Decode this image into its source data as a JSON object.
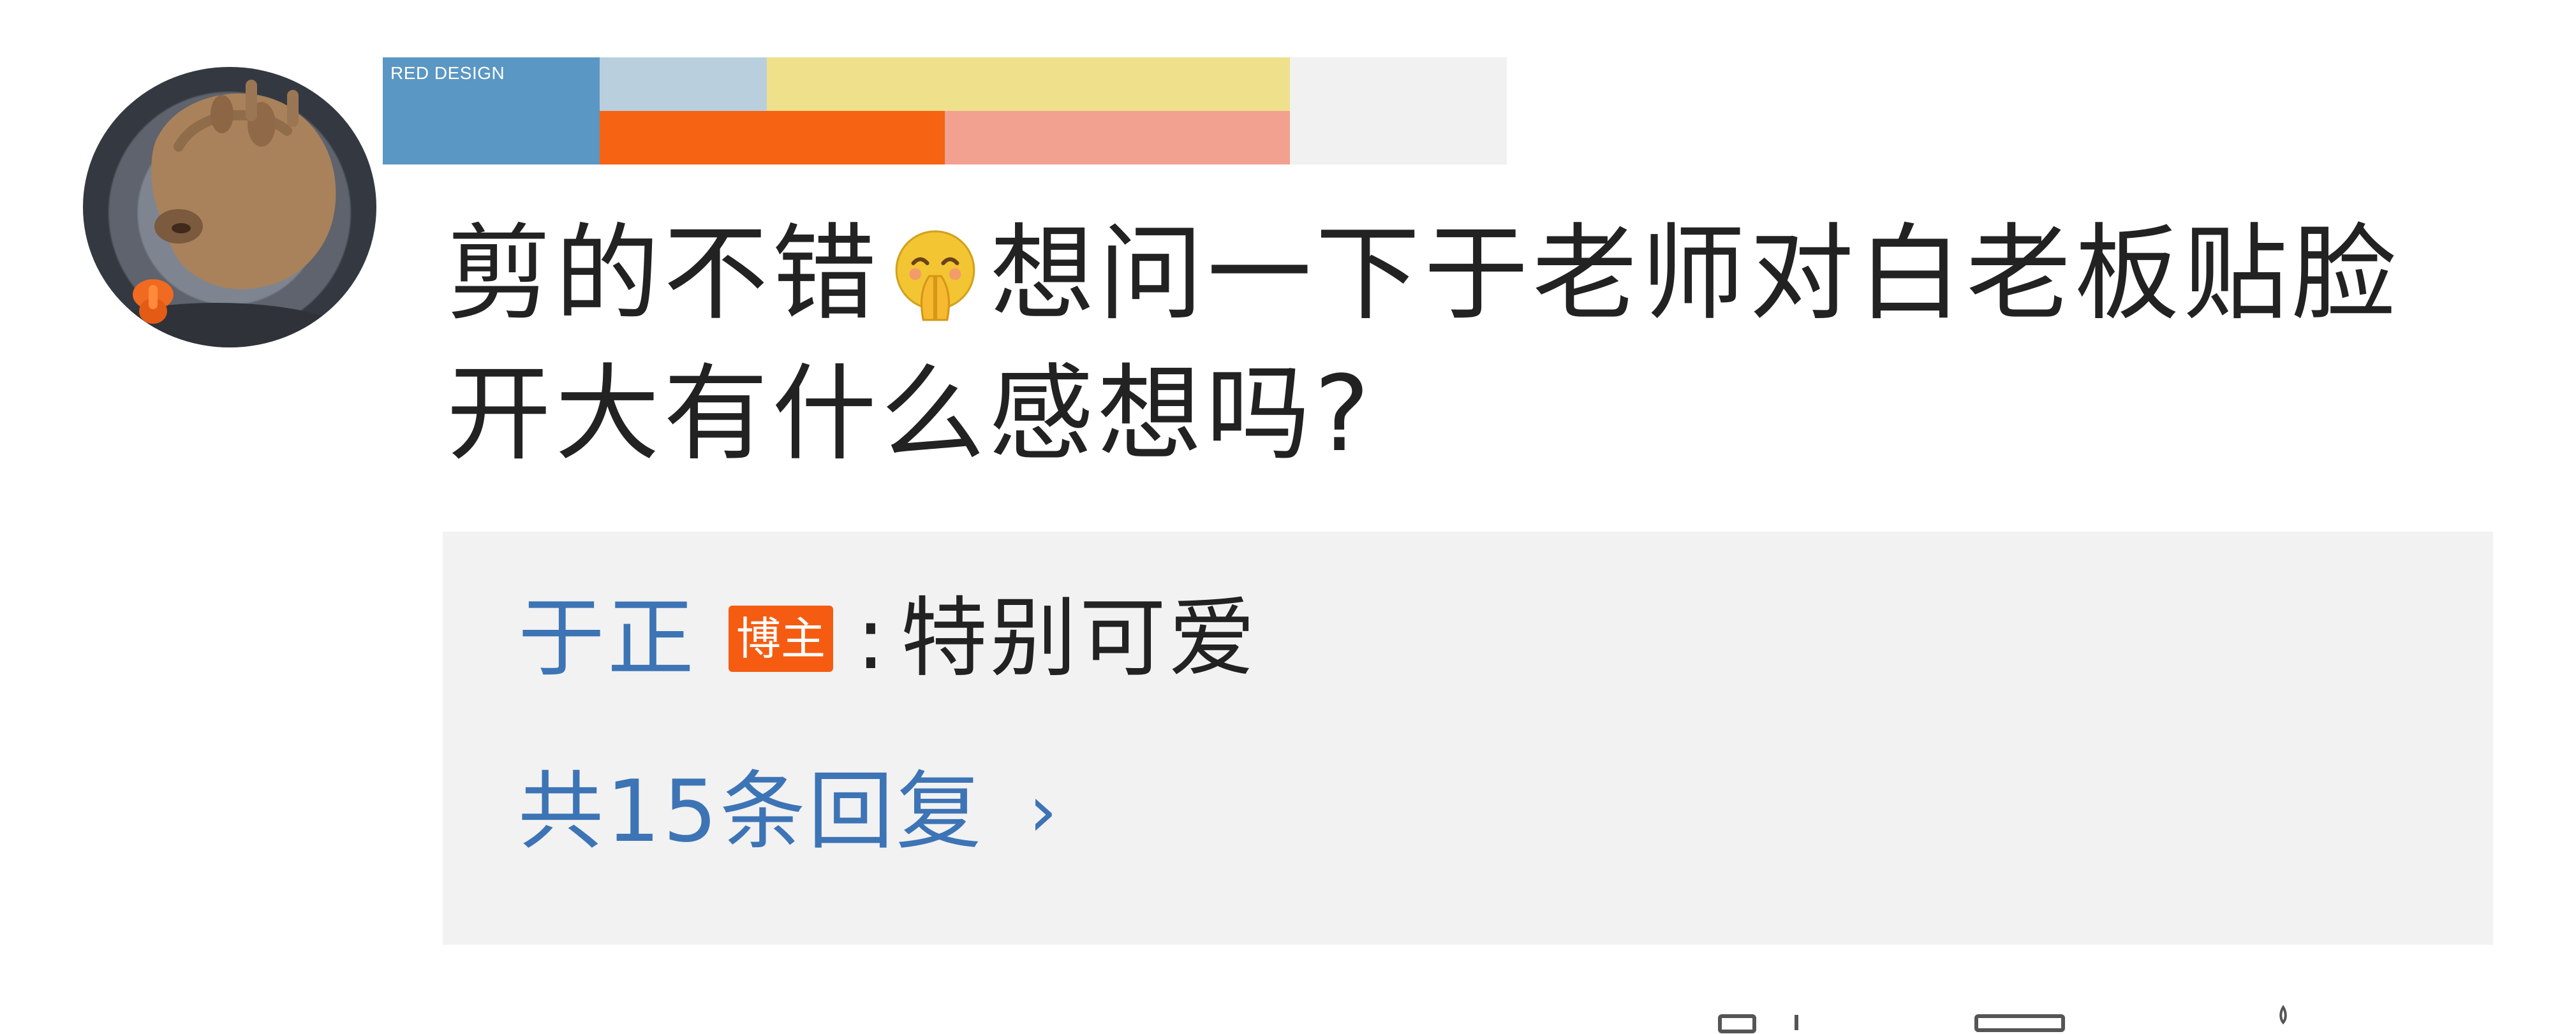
{
  "banner": {
    "brand_text": "RED\nDESIGN",
    "colors": [
      "#5a97c4",
      "#b9cfdd",
      "#efe08c",
      "#f1f1f1",
      "#f66312",
      "#f2a08f"
    ]
  },
  "comment": {
    "lines": [
      "剪的不错",
      "想问一下于老师对白老板贴脸",
      "开大有什么感想吗?"
    ],
    "emoji_name": "smiling-face-with-hands-icon"
  },
  "reply": {
    "author": "于正",
    "badge": "博主",
    "text": "特别可爱",
    "more_label": "共15条回复",
    "chevron_icon": "chevron-right-icon"
  },
  "colors": {
    "link_blue": "#3d74b5",
    "reply_bg": "#f2f2f2",
    "badge_orange": "#f55c11",
    "text_dark": "#222222"
  }
}
